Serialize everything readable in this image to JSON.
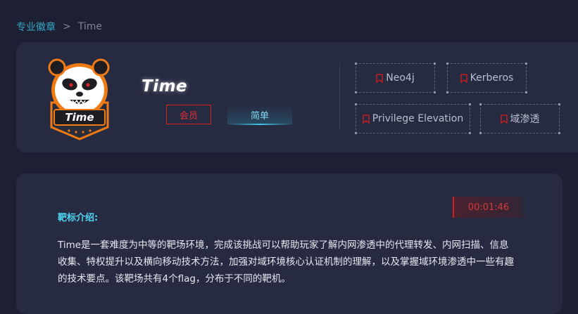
{
  "breadcrumb": {
    "parent": "专业徽章",
    "separator": ">",
    "current": "Time"
  },
  "lab": {
    "title": "Time",
    "logo_text": "Time",
    "member_label": "会员",
    "difficulty_label": "简单"
  },
  "tags": [
    {
      "label": "Neo4j",
      "icon": "bookmark-icon"
    },
    {
      "label": "Kerberos",
      "icon": "bookmark-icon"
    },
    {
      "label": "Privilege Elevation",
      "icon": "bookmark-icon"
    },
    {
      "label": "域渗透",
      "icon": "bookmark-icon"
    }
  ],
  "intro": {
    "heading": "靶标介绍:",
    "timer": "00:01:46",
    "description": "Time是一套难度为中等的靶场环境，完成该挑战可以帮助玩家了解内网渗透中的代理转发、内网扫描、信息收集、特权提升以及横向移动技术方法，加强对域环境核心认证机制的理解，以及掌握域环境渗透中一些有趣的技术要点。该靶场共有4个flag，分布于不同的靶机。"
  },
  "colors": {
    "background": "#1c2032",
    "card": "#262b42",
    "accent_cyan": "#36a6c4",
    "accent_red": "#d61d1d"
  }
}
